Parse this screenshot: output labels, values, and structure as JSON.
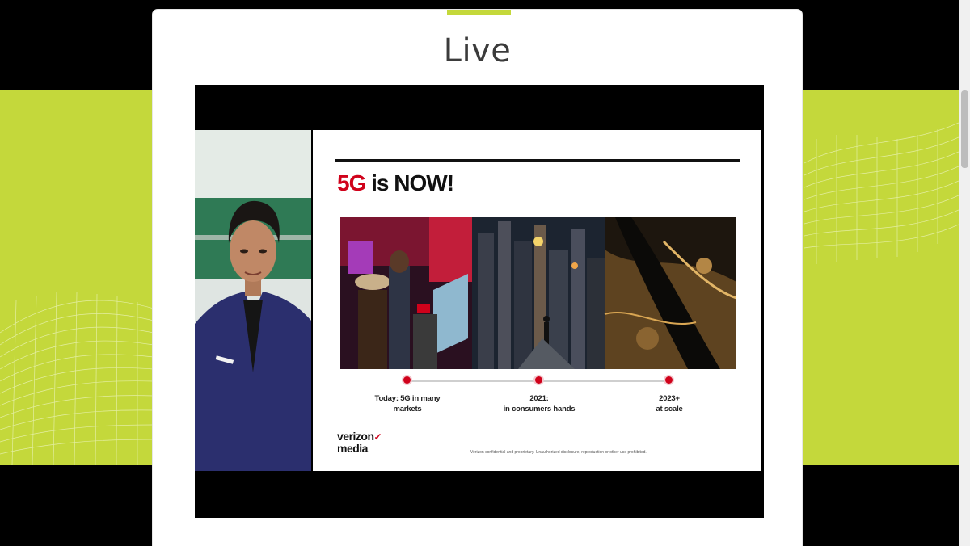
{
  "page": {
    "title": "Live"
  },
  "colors": {
    "brand_green": "#c4d83b",
    "accent_red": "#d0021b"
  },
  "slide": {
    "heading_accent": "5G",
    "heading_rest": " is NOW!",
    "timeline": [
      {
        "line1": "Today: 5G in many",
        "line2": "markets"
      },
      {
        "line1": "2021:",
        "line2": "in consumers hands"
      },
      {
        "line1": "2023+",
        "line2": "at scale"
      }
    ],
    "brand_line1": "verizon",
    "brand_check": "✓",
    "brand_line2": "media",
    "legal": "Verizon confidential and proprietary. Unauthorized disclosure, reproduction or other use prohibited."
  },
  "icons": {
    "brand_check": "checkmark-icon"
  }
}
